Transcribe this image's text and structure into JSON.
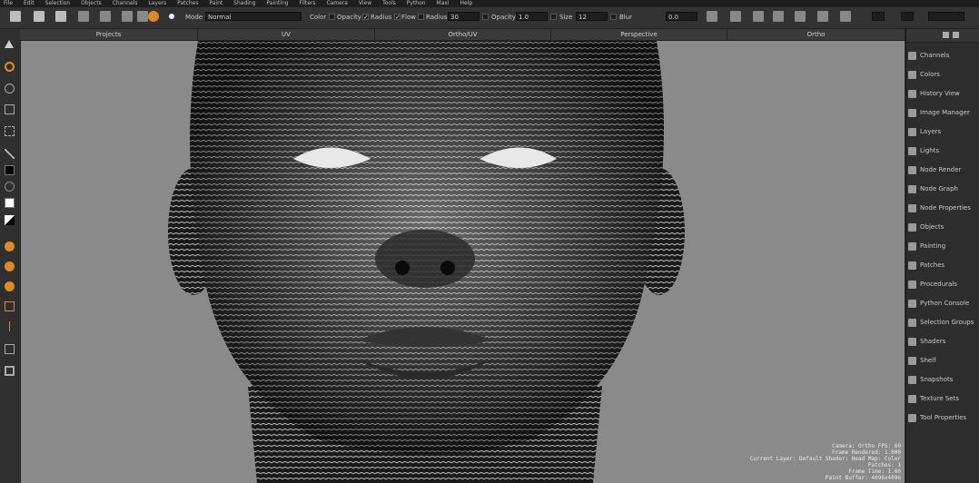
{
  "menu": [
    "File",
    "Edit",
    "Selection",
    "Objects",
    "Channels",
    "Layers",
    "Patches",
    "Paint",
    "Shading",
    "Painting",
    "Filters",
    "Camera",
    "View",
    "Tools",
    "Python",
    "Maxi",
    "Help"
  ],
  "toolbar": {
    "brush_mode_label": "Mode",
    "brush_mode_value": "Normal",
    "color_label": "Color",
    "opacity_label": "Opacity",
    "radius_label": "Radius",
    "flow_label": "Flow",
    "radius_value": "30",
    "opacity_value": "1.0",
    "size_label": "Size",
    "size_value": "12",
    "blur_label": "Blur",
    "blur_value": "0.0"
  },
  "tabs": [
    "Projects",
    "UV",
    "Ortho/UV",
    "Perspective",
    "Ortho"
  ],
  "right_panel": {
    "items": [
      "Channels",
      "Colors",
      "History View",
      "Image Manager",
      "Layers",
      "Lights",
      "Node Render",
      "Node Graph",
      "Node Properties",
      "Objects",
      "Painting",
      "Patches",
      "Procedurals",
      "Python Console",
      "Selection Groups",
      "Shaders",
      "Shelf",
      "Snapshots",
      "Texture Sets",
      "Tool Properties"
    ]
  },
  "stats": [
    "Camera: Ortho  FPS: 60",
    "Frame Rendered: 1.000",
    "Current Layer: Default  Shader: Head  Map: Color",
    "Patches: 1",
    "Frame Time: 1.00",
    "Paint Buffer: 4096x4096"
  ]
}
